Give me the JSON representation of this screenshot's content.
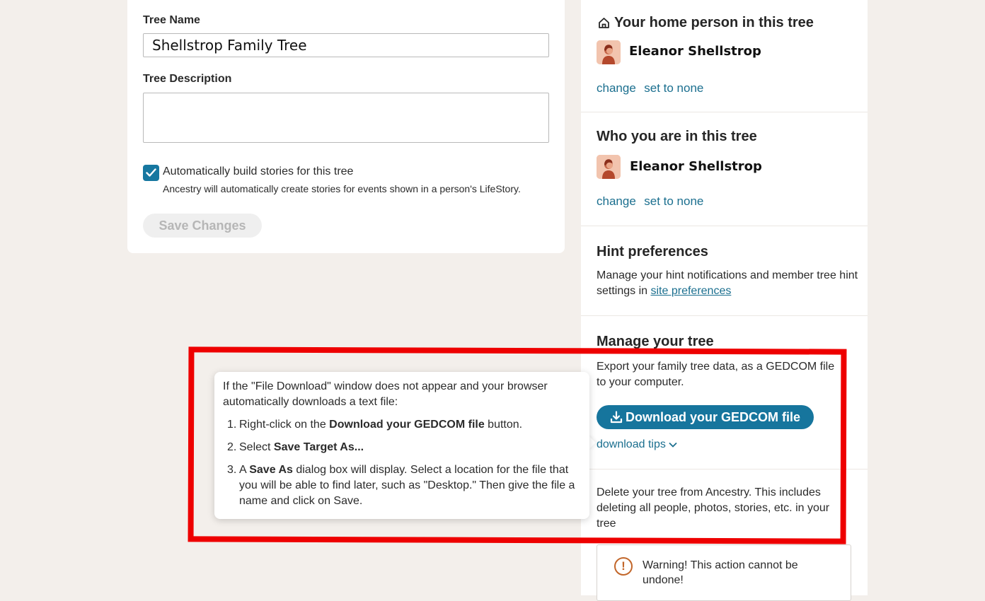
{
  "tree_settings": {
    "tree_name_label": "Tree Name",
    "tree_name_value": "Shellstrop Family Tree",
    "tree_description_label": "Tree Description",
    "tree_description_value": "",
    "auto_stories_checked": true,
    "auto_stories_label": "Automatically build stories for this tree",
    "auto_stories_help": "Ancestry will automatically create stories for events shown in a person's LifeStory.",
    "save_button_label": "Save Changes"
  },
  "home_person": {
    "title": "Your home person in this tree",
    "icon": "home-icon",
    "name": "Eleanor Shellstrop",
    "change_link": "change",
    "none_link": "set to none"
  },
  "who_you_are": {
    "title": "Who you are in this tree",
    "name": "Eleanor Shellstrop",
    "change_link": "change",
    "none_link": "set to none"
  },
  "hint_preferences": {
    "title": "Hint preferences",
    "text": "Manage your hint notifications and member tree hint settings in",
    "link": "site preferences"
  },
  "manage_tree": {
    "title": "Manage your tree",
    "export_text": "Export your family tree data, as a GEDCOM file to your computer.",
    "download_button": "Download your GEDCOM file",
    "download_icon": "download-icon",
    "tips_link": "download tips",
    "delete_text": "Delete your tree from Ancestry. This includes deleting all people, photos, stories, etc. in your tree",
    "warning_text": "Warning! This action cannot be undone!"
  },
  "tooltip": {
    "intro": "If the \"File Download\" window does not appear and your browser automatically downloads a text file:",
    "steps": [
      {
        "num": "1.",
        "pre": "Right-click on the ",
        "bold": "Download your GEDCOM file",
        "post": " button."
      },
      {
        "num": "2.",
        "pre": "Select ",
        "bold": "Save Target As...",
        "post": ""
      },
      {
        "num": "3.",
        "pre": "A ",
        "bold": "Save As",
        "post": " dialog box will display. Select a location for the file that you will be able to find later, such as \"Desktop.\" Then give the file a name and click on Save."
      }
    ]
  },
  "colors": {
    "accent": "#16759d",
    "link": "#1b6f8f",
    "highlight_frame": "#ee0000",
    "warning": "#c2662a",
    "page_background": "#f3efeb"
  }
}
